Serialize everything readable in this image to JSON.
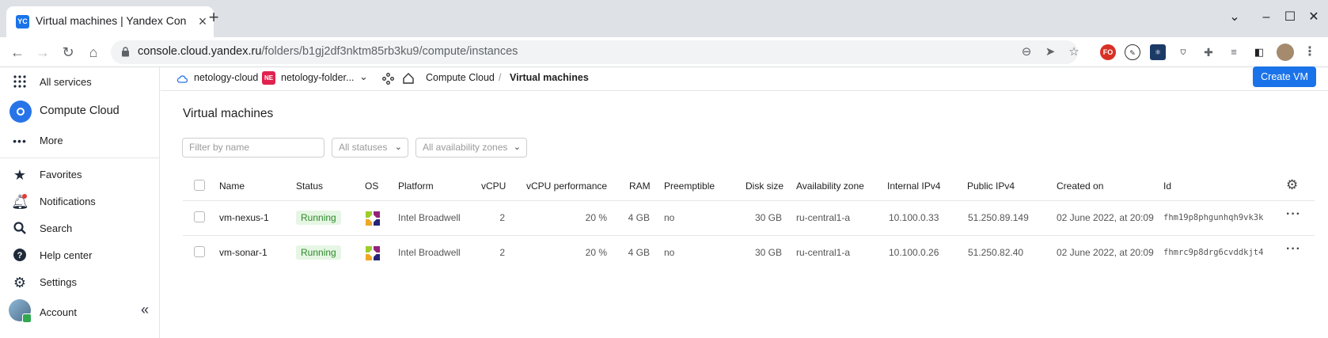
{
  "browser": {
    "tab_title": "Virtual machines | Yandex Con",
    "favicon_text": "YC",
    "url_host": "console.cloud.yandex.ru",
    "url_path": "/folders/b1gj2df3nktm85rb3ku9/compute/instances",
    "ext_fo": "FO"
  },
  "sidebar": {
    "all_services": "All services",
    "compute_cloud": "Compute Cloud",
    "more": "More",
    "favorites": "Favorites",
    "notifications": "Notifications",
    "search": "Search",
    "help_center": "Help center",
    "settings": "Settings",
    "account": "Account"
  },
  "topbar": {
    "cloud": "netology-cloud",
    "folder_badge": "NE",
    "folder": "netology-folder...",
    "service": "Compute Cloud",
    "separator": "/",
    "current": "Virtual machines",
    "create_button": "Create VM"
  },
  "page": {
    "title": "Virtual machines",
    "filter_placeholder": "Filter by name",
    "status_filter": "All statuses",
    "zone_filter": "All availability zones"
  },
  "table": {
    "columns": [
      "Name",
      "Status",
      "OS",
      "Platform",
      "vCPU",
      "vCPU performance",
      "RAM",
      "Preemptible",
      "Disk size",
      "Availability zone",
      "Internal IPv4",
      "Public IPv4",
      "Created on",
      "Id"
    ],
    "rows": [
      {
        "name": "vm-nexus-1",
        "status": "Running",
        "platform": "Intel Broadwell",
        "vcpu": "2",
        "vcpu_perf": "20 %",
        "ram": "4 GB",
        "preemptible": "no",
        "disk": "30 GB",
        "zone": "ru-central1-a",
        "internal_ip": "10.100.0.33",
        "public_ip": "51.250.89.149",
        "created": "02 June 2022, at 20:09",
        "id": "fhm19p8phgunhqh9vk3k"
      },
      {
        "name": "vm-sonar-1",
        "status": "Running",
        "platform": "Intel Broadwell",
        "vcpu": "2",
        "vcpu_perf": "20 %",
        "ram": "4 GB",
        "preemptible": "no",
        "disk": "30 GB",
        "zone": "ru-central1-a",
        "internal_ip": "10.100.0.26",
        "public_ip": "51.250.82.40",
        "created": "02 June 2022, at 20:09",
        "id": "fhmrc9p8drg6cvddkjt4"
      }
    ]
  },
  "colors": {
    "accent": "#1a73e8",
    "running_bg": "#e6f6e4",
    "running_text": "#2d8a28",
    "folder_badge": "#e0234e"
  }
}
